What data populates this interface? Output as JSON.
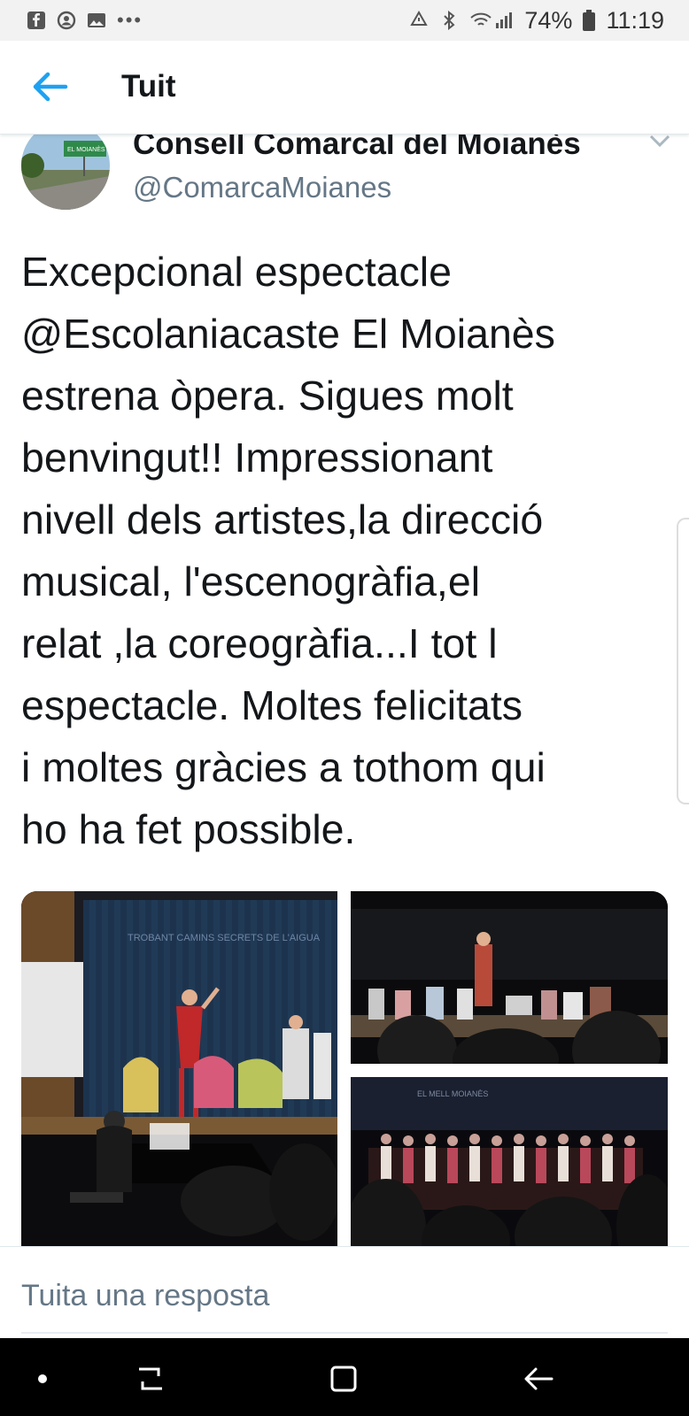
{
  "status_bar": {
    "left_icons": [
      "facebook-icon",
      "instagram-icon",
      "gallery-icon",
      "more-dots-icon"
    ],
    "battery": "74%",
    "time": "11:19"
  },
  "app_bar": {
    "back_icon": "arrow-left-icon",
    "title": "Tuit",
    "accent": "#1da1f2"
  },
  "tweet": {
    "author_name": "Consell Comarcal del Moianès",
    "author_handle": "@ComarcaMoianes",
    "avatar_sign_text": "EL MOIANÈS",
    "text_lines": [
      "Excepcional espectacle",
      "@Escolaniacaste El Moianès",
      "estrena òpera. Sigues molt",
      "benvingut!! Impressionant",
      "nivell dels artistes,la direcció",
      "musical, l'escenogràfia,el",
      "relat ,la  coreogràfia...I tot l",
      "espectacle. Moltes felicitats",
      "i moltes gràcies a tothom qui",
      "ho ha fet possible."
    ],
    "photos": [
      {
        "alt": "stage-photo-piano",
        "stage_text": "TROBANT CAMINS SECRETS DE L'AIGUA"
      },
      {
        "alt": "stage-photo-performers",
        "stage_text": ""
      },
      {
        "alt": "stage-photo-choir",
        "stage_text": "EL MELL MOIANÈS"
      }
    ]
  },
  "reply_bar": {
    "placeholder": "Tuita una resposta"
  },
  "nav_bar": {
    "icons": [
      "dot-icon",
      "recent-apps-icon",
      "home-square-icon",
      "back-icon"
    ]
  }
}
